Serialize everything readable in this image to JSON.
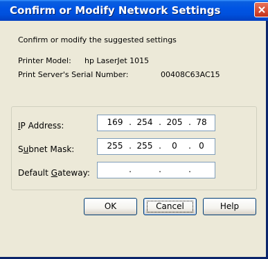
{
  "window": {
    "title": "Confirm or Modify Network Settings",
    "close_icon": "close-icon",
    "accent_color": "#0054e3"
  },
  "intro_text": "Confirm or modify the suggested settings",
  "printer": {
    "model_label": "Printer Model:",
    "model_value": "hp LaserJet 1015",
    "serial_label": "Print Server's Serial Number:",
    "serial_value": "00408C63AC15"
  },
  "fields": {
    "ip": {
      "label_pre": "",
      "label_mnemonic": "I",
      "label_post": "P Address:",
      "octets": [
        "169",
        "254",
        "205",
        "78"
      ]
    },
    "subnet": {
      "label_pre": "S",
      "label_mnemonic": "u",
      "label_post": "bnet Mask:",
      "octets": [
        "255",
        "255",
        "0",
        "0"
      ]
    },
    "gateway": {
      "label_pre": "Default ",
      "label_mnemonic": "G",
      "label_post": "ateway:",
      "octets": [
        "",
        "",
        "",
        ""
      ]
    },
    "separator": "."
  },
  "buttons": {
    "ok": "OK",
    "cancel": "Cancel",
    "help": "Help"
  }
}
